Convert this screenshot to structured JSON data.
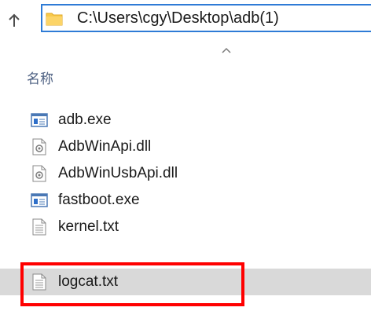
{
  "address": {
    "path": "C:\\Users\\cgy\\Desktop\\adb(1)"
  },
  "header": {
    "name_column": "名称",
    "sort_direction": "ascending"
  },
  "files": [
    {
      "name": "adb.exe",
      "icon": "exe-icon",
      "selected": false
    },
    {
      "name": "AdbWinApi.dll",
      "icon": "dll-icon",
      "selected": false
    },
    {
      "name": "AdbWinUsbApi.dll",
      "icon": "dll-icon",
      "selected": false
    },
    {
      "name": "fastboot.exe",
      "icon": "exe-icon",
      "selected": false
    },
    {
      "name": "kernel.txt",
      "icon": "txt-icon",
      "selected": false
    },
    {
      "name": "logcat.txt",
      "icon": "txt-icon",
      "selected": true
    }
  ],
  "colors": {
    "address_border": "#2e7bd6",
    "folder_yellow": "#f8c94a",
    "selection_bg": "#d9d9d9",
    "highlight_red": "#ff0000"
  }
}
